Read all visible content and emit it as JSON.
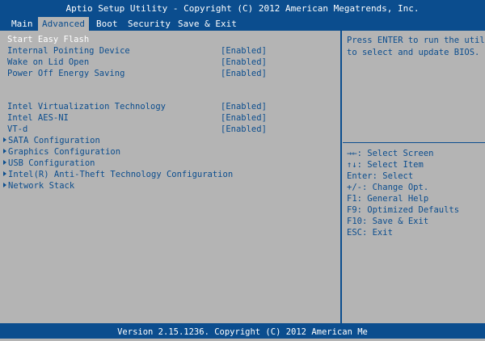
{
  "header": {
    "title": "Aptio Setup Utility - Copyright (C) 2012 American Megatrends, Inc."
  },
  "tabs": [
    "Main",
    "Advanced",
    "Boot",
    "Security",
    "Save & Exit"
  ],
  "selected_item": "Start Easy Flash",
  "settings": [
    {
      "label": "Internal Pointing Device",
      "value": "[Enabled]"
    },
    {
      "label": "Wake on Lid Open",
      "value": "[Enabled]"
    },
    {
      "label": "Power Off Energy Saving",
      "value": "[Enabled]"
    },
    {
      "label": "Intel Virtualization Technology",
      "value": "[Enabled]"
    },
    {
      "label": "Intel AES-NI",
      "value": "[Enabled]"
    },
    {
      "label": "VT-d",
      "value": "[Enabled]"
    }
  ],
  "submenus": [
    "SATA Configuration",
    "Graphics Configuration",
    "USB Configuration",
    "Intel(R) Anti-Theft Technology Configuration",
    "Network Stack"
  ],
  "help": {
    "line1": "Press ENTER to run the utility",
    "line2": "to select and update BIOS."
  },
  "keys": [
    "→←: Select Screen",
    "↑↓: Select Item",
    "Enter: Select",
    "+/-: Change Opt.",
    "F1: General Help",
    "F9: Optimized Defaults",
    "F10: Save & Exit",
    "ESC: Exit"
  ],
  "footer": {
    "text": "Version 2.15.1236. Copyright (C) 2012 American Me"
  },
  "colors": {
    "bar": "#0b4d8e",
    "panel": "#b4b4b4",
    "text": "#0b4d8e",
    "selected": "#ffffff"
  }
}
